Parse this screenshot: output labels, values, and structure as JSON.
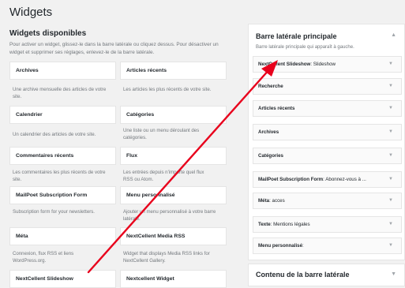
{
  "page": {
    "title": "Widgets"
  },
  "available": {
    "title": "Widgets disponibles",
    "description": "Pour activer un widget, glissez-le dans la barre latérale ou cliquez dessus. Pour désactiver un widget et supprimer ses réglages, enlevez-le de la barre latérale."
  },
  "widgets": [
    {
      "title": "Archives",
      "desc": "Une archive mensuelle des articles de votre site."
    },
    {
      "title": "Articles récents",
      "desc": "Les articles les plus récents de votre site."
    },
    {
      "title": "Calendrier",
      "desc": "Un calendrier des articles de votre site."
    },
    {
      "title": "Catégories",
      "desc": "Une liste ou un menu déroulant des catégories."
    },
    {
      "title": "Commentaires récents",
      "desc": "Les commentaires les plus récents de votre site."
    },
    {
      "title": "Flux",
      "desc": "Les entrées depuis n'importe quel flux RSS ou Atom."
    },
    {
      "title": "MailPoet Subscription Form",
      "desc": "Subscription form for your newsletters."
    },
    {
      "title": "Menu personnalisé",
      "desc": "Ajouter un menu personnalisé à votre barre latérale."
    },
    {
      "title": "Méta",
      "desc": "Connexion, flux RSS et liens WordPress.org."
    },
    {
      "title": "NextCellent Media RSS",
      "desc": "Widget that displays Media RSS links for NextCellent Gallery."
    },
    {
      "title": "NextCellent Slideshow",
      "desc": ""
    },
    {
      "title": "Nextcellent Widget",
      "desc": ""
    }
  ],
  "primary_sidebar": {
    "title": "Barre latérale principale",
    "description": "Barre latérale principale qui apparaît à gauche.",
    "toggle_icon": "triangle-up",
    "items": [
      {
        "label": "NextCellent Slideshow",
        "sub": ": Slideshow"
      },
      {
        "label": "Recherche",
        "sub": ""
      },
      {
        "label": "Articles récents",
        "sub": ""
      },
      {
        "label": "Archives",
        "sub": ""
      },
      {
        "label": "Catégories",
        "sub": ""
      },
      {
        "label": "MailPoet Subscription Form",
        "sub": ": Abonnez-vous à ..."
      },
      {
        "label": "Méta",
        "sub": ": acces"
      },
      {
        "label": "Texte",
        "sub": ": Mentions légales"
      },
      {
        "label": "Menu personnalisé",
        "sub": ":"
      }
    ]
  },
  "content_sidebar": {
    "title": "Contenu de la barre latérale",
    "toggle_icon": "triangle-down"
  },
  "annotation": {
    "arrow_color": "#e8001c"
  }
}
